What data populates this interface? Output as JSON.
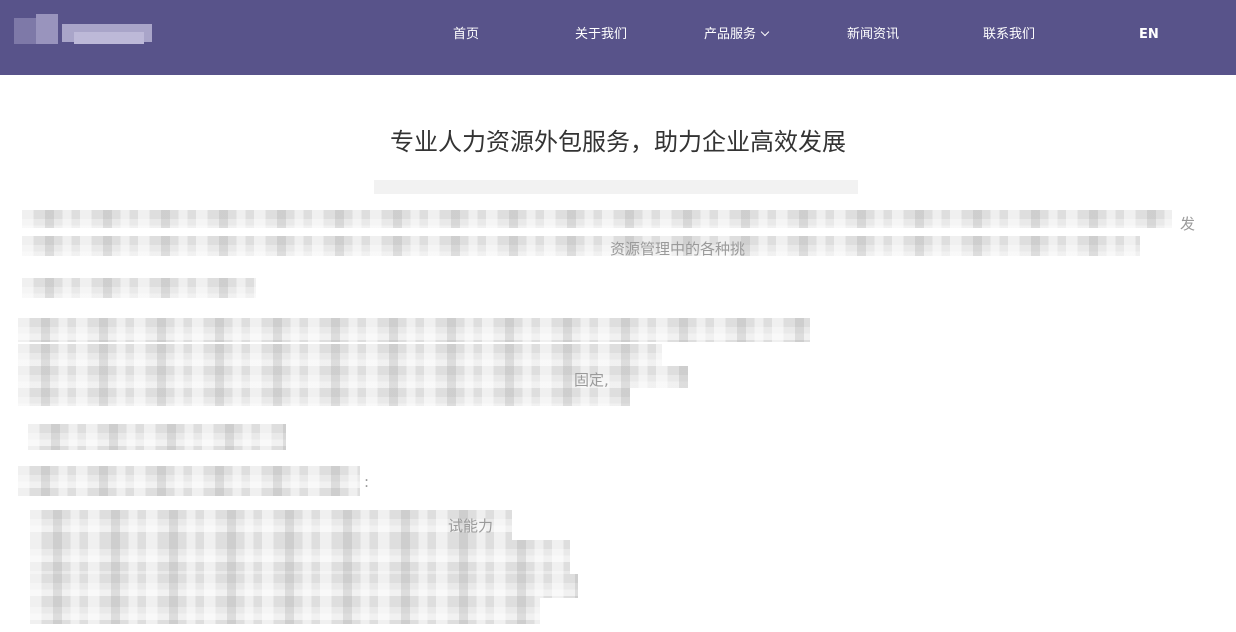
{
  "nav": {
    "home": "首页",
    "about": "关于我们",
    "products": "产品服务",
    "news": "新闻资讯",
    "contact": "联系我们",
    "lang": "EN"
  },
  "page": {
    "title": "专业人力资源外包服务，助力企业高效发展"
  },
  "fragments": {
    "fa": "发",
    "colon": ":",
    "ding": "固定,",
    "ziyuan": "资源管理中的各种挑",
    "shi": "试能力"
  },
  "colors": {
    "nav_bg": "#58538a",
    "title": "#333333"
  }
}
